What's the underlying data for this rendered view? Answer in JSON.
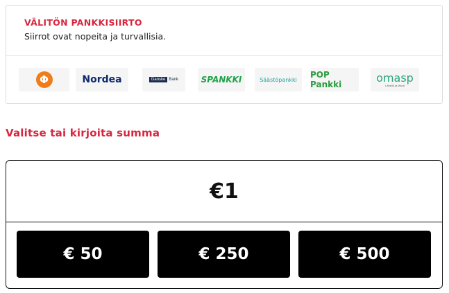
{
  "bank_card": {
    "title": "VÄLITÖN PANKKISIIRTO",
    "subtitle": "Siirrot ovat nopeita ja turvallisia.",
    "logos": {
      "op": "Φ",
      "nordea": "Nordea",
      "danske_box": "Danske",
      "danske_text": "Bank",
      "spankki": "SPANKKI",
      "saastopankki": "Säästöpankki",
      "pop": "POP Pankki",
      "omasp": "omasp",
      "omasp_sub": "Lähellä ja läsnä"
    }
  },
  "amount_section": {
    "heading": "Valitse tai kirjoita summa",
    "value": "€1",
    "presets": [
      "€ 50",
      "€ 250",
      "€ 500"
    ]
  },
  "colors": {
    "accent": "#d8263f",
    "button_bg": "#000000",
    "op_orange": "#f07d1b",
    "nordea_blue": "#0e2a6d"
  }
}
